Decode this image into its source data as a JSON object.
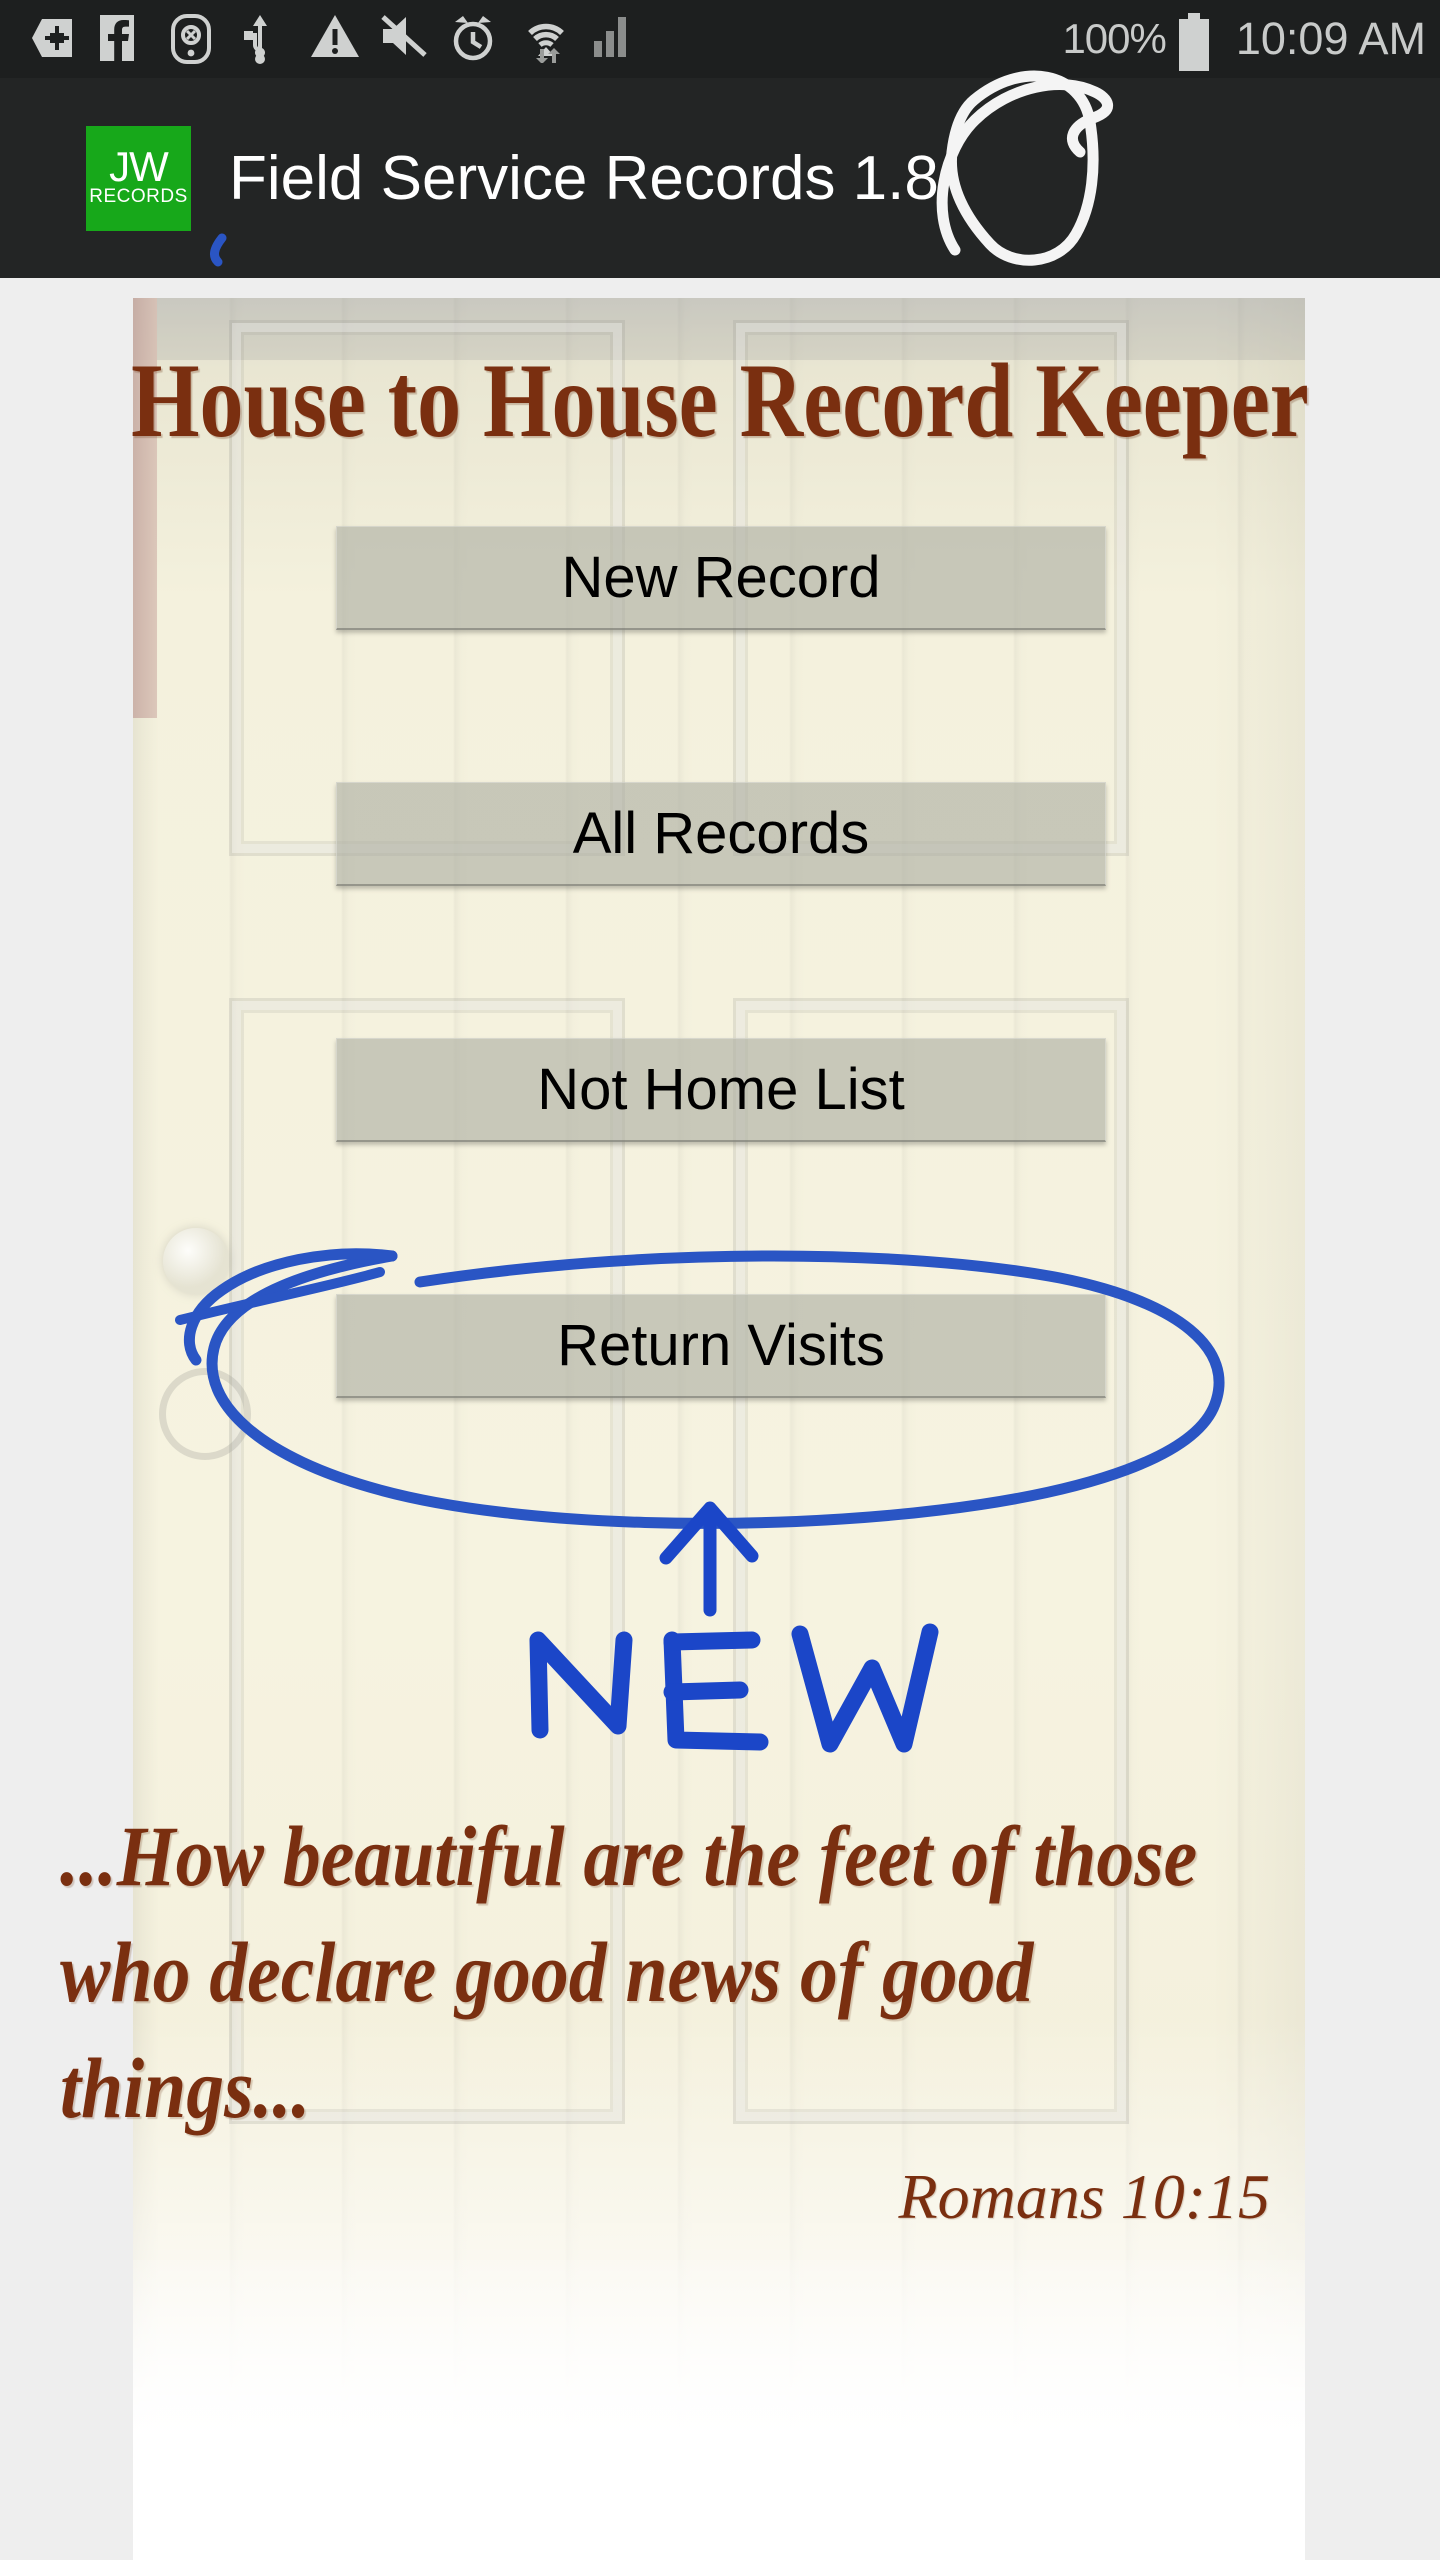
{
  "status_bar": {
    "icons": [
      {
        "name": "vpn-key-plus-icon",
        "label": "VPN"
      },
      {
        "name": "facebook-icon",
        "label": "Facebook"
      },
      {
        "name": "pedometer-icon",
        "label": "S Health"
      },
      {
        "name": "usb-icon",
        "label": "USB"
      },
      {
        "name": "warning-triangle-icon",
        "label": "Warning"
      },
      {
        "name": "mute-icon",
        "label": "Sound off"
      },
      {
        "name": "alarm-clock-icon",
        "label": "Alarm"
      },
      {
        "name": "wifi-icon",
        "label": "Wi-Fi"
      },
      {
        "name": "cellular-signal-icon",
        "label": "Signal"
      }
    ],
    "battery_percent": "100%",
    "battery_icon": "battery-full-icon",
    "clock": "10:09 AM"
  },
  "app_bar": {
    "logo": {
      "line1": "JW",
      "line2": "RECORDS",
      "color": "#17a81a"
    },
    "title": "Field Service Records 1.8"
  },
  "main": {
    "headline": "House to House Record Keeper",
    "buttons": [
      {
        "label": "New Record",
        "name": "new-record-button"
      },
      {
        "label": "All Records",
        "name": "all-records-button"
      },
      {
        "label": "Not Home List",
        "name": "not-home-list-button"
      },
      {
        "label": "Return Visits",
        "name": "return-visits-button"
      }
    ],
    "scripture": "...How beautiful are the feet of those who declare good news of good things...",
    "citation": "Romans 10:15"
  },
  "annotations": {
    "version_circle": {
      "name": "version-circle-annotation",
      "color": "#f2f2f2",
      "target": "1.8"
    },
    "button_ellipse": {
      "name": "return-visits-ellipse-annotation",
      "color": "#2a55c4"
    },
    "arrow": {
      "name": "new-arrow-annotation",
      "color": "#1b46c8"
    },
    "new_label": {
      "text": "NEW",
      "name": "new-handwritten-label",
      "color": "#1b46c8"
    }
  },
  "colors": {
    "status_bar_bg": "#1d1f1f",
    "app_bar_bg": "#232525",
    "page_bg": "#eeeeee",
    "door": "#f4f1dd",
    "heading_brown": "#7a2f10",
    "button_fill": "rgba(176,178,166,.66)",
    "annotation_blue": "#1b46c8"
  }
}
